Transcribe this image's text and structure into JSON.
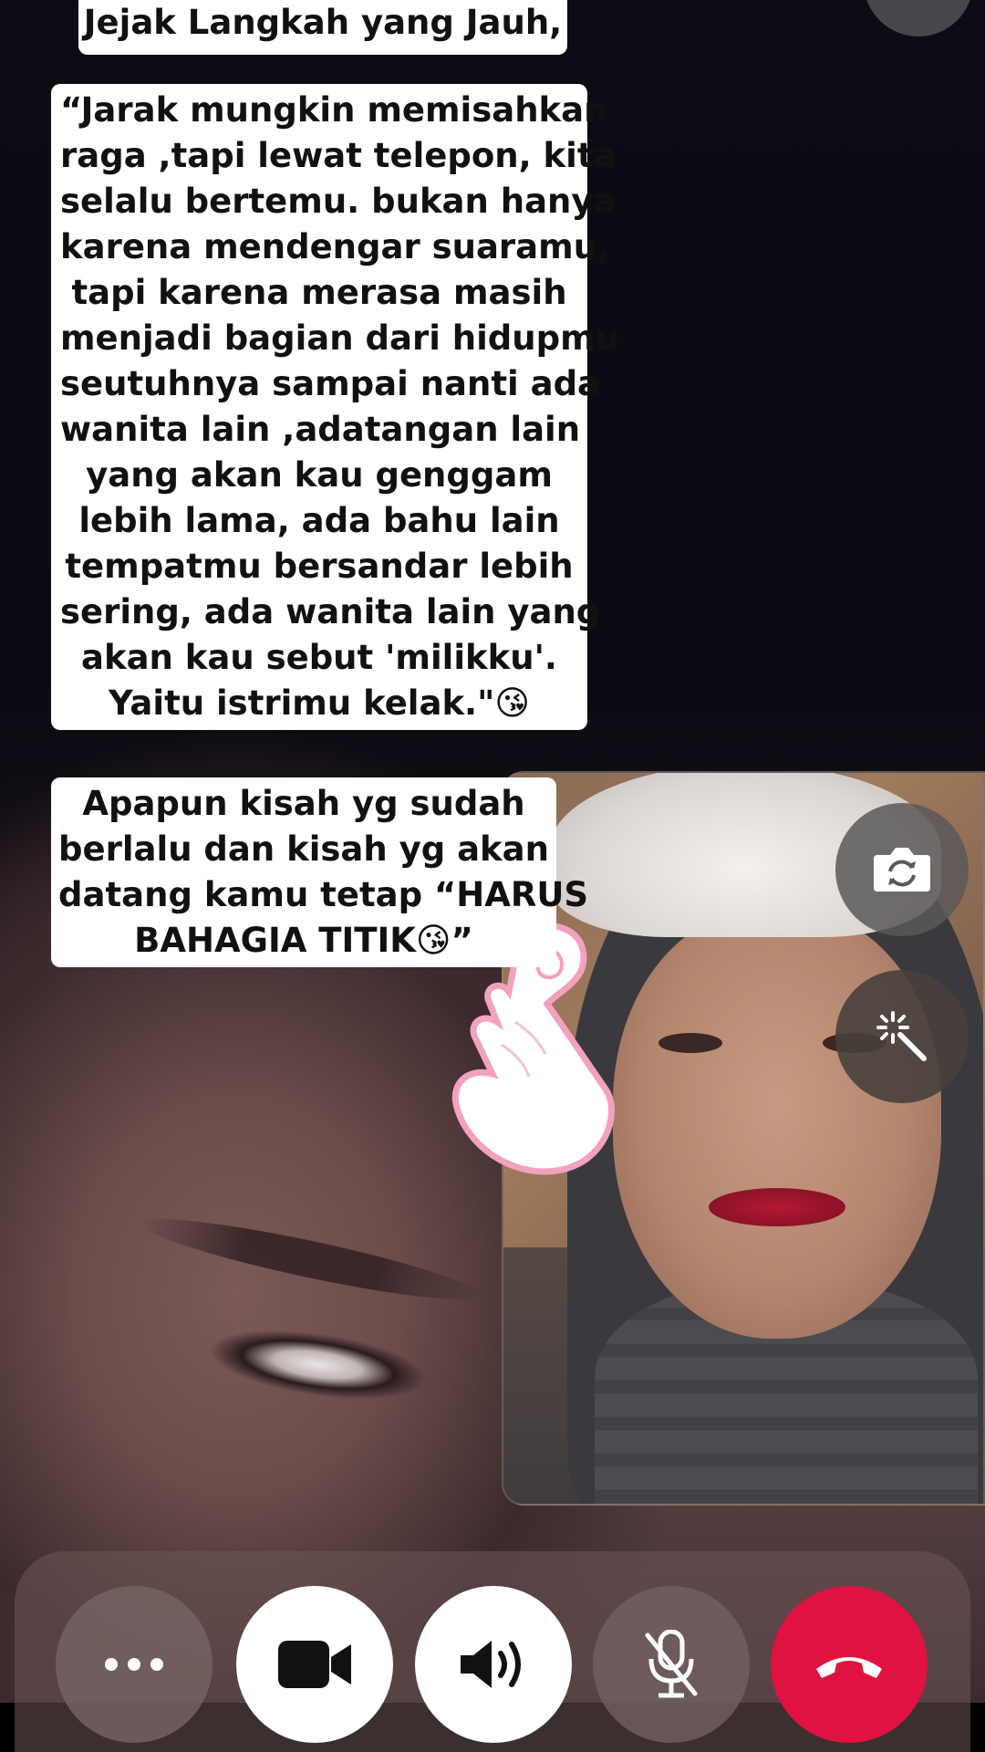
{
  "captions": {
    "title": "Jejak Langkah yang Jauh,",
    "quote_lines": [
      "“Jarak mungkin memisahkan",
      "raga ,tapi lewat telepon, kita",
      "selalu bertemu. bukan hanya",
      "karena mendengar suaramu,",
      "tapi karena merasa masih",
      "menjadi bagian dari hidupmu",
      "seutuhnya sampai nanti ada",
      "wanita lain ,adatangan lain",
      "yang akan kau genggam",
      "lebih lama, ada bahu lain",
      "tempatmu bersandar lebih",
      "sering, ada wanita lain yang",
      "akan kau sebut 'milikku'.",
      "Yaitu istrimu kelak.\"😘"
    ],
    "ending_lines": [
      "Apapun kisah yg sudah",
      "berlalu dan kisah yg akan",
      "datang  kamu tetap “HARUS",
      "BAHAGIA TITIK😘”"
    ]
  },
  "controls": {
    "more": "more-options-icon",
    "video": "video-camera-icon",
    "speaker": "speaker-icon",
    "mic": "microphone-muted-icon",
    "end": "end-call-icon"
  },
  "side_buttons": {
    "flip": "camera-flip-icon",
    "effects": "magic-wand-icon"
  },
  "colors": {
    "end_call": "#e0123f",
    "caption_bg": "#ffffff",
    "caption_text": "#111111"
  }
}
